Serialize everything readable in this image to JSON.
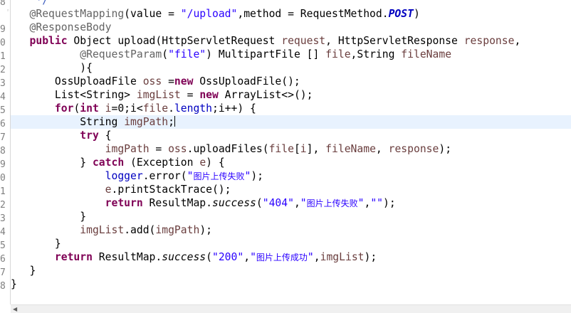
{
  "gutter": {
    "line_numbers": [
      "8",
      "9",
      "0",
      "1",
      "2",
      "3",
      "4",
      "5",
      "6",
      "7",
      "8",
      "9",
      "0",
      "1",
      "2",
      "3",
      "4",
      "5",
      "6",
      "7",
      "8"
    ]
  },
  "code": {
    "comment_tail": "*/",
    "annotation_mapping": "@RequestMapping",
    "mapping_args_a": "(value = ",
    "mapping_url": "\"/upload\"",
    "mapping_args_b": ",method = RequestMethod.",
    "mapping_post": "POST",
    "mapping_close": ")",
    "annotation_body": "@ResponseBody",
    "kw_public": "public",
    "sig_a": " Object upload(HttpServletRequest ",
    "param_request": "request",
    "sig_b": ", HttpServletResponse ",
    "param_response": "response",
    "sig_c": ",",
    "annotation_param": "@RequestParam",
    "param_ann_open": "(",
    "param_ann_value": "\"file\"",
    "param_ann_close": ")",
    "sig_d": " MultipartFile [] ",
    "param_file": "file",
    "sig_e": ",String ",
    "param_filename": "fileName",
    "sig_close": "){",
    "l4_a": "OssUploadFile ",
    "l4_var": "oss",
    "l4_b": " =",
    "kw_new": "new",
    "l4_c": " OssUploadFile();",
    "l5_a": "List<String> ",
    "l5_var": "imgList",
    "l5_b": " = ",
    "l5_c": " ArrayList<>();",
    "kw_for": "for",
    "l6_a": "(",
    "kw_int": "int",
    "l6_var_i": " i",
    "l6_b": "=0;i<",
    "l6_file": "file",
    "l6_c": ".",
    "l6_length": "length",
    "l6_d": ";i++) {",
    "l7_a": "String ",
    "l7_var": "imgPath",
    "l7_b": ";",
    "kw_try": "try",
    "l8_b": " {",
    "l9_var": "imgPath",
    "l9_a": " = ",
    "l9_oss": "oss",
    "l9_b": ".uploadFiles(",
    "l9_file": "file",
    "l9_c": "[",
    "l9_i": "i",
    "l9_d": "], ",
    "l9_filename": "fileName",
    "l9_e": ", ",
    "l9_response": "response",
    "l9_f": ");",
    "l10_a": "} ",
    "kw_catch": "catch",
    "l10_b": " (Exception ",
    "l10_e": "e",
    "l10_c": ") {",
    "l11_logger": "logger",
    "l11_a": ".error(",
    "l11_q1": "\"",
    "l11_msg": "图片上传失败",
    "l11_q2": "\"",
    "l11_b": ");",
    "l12_e": "e",
    "l12_a": ".printStackTrace();",
    "kw_return": "return",
    "l13_a": " ResultMap.",
    "l13_success": "success",
    "l13_b": "(",
    "l13_code": "\"404\"",
    "l13_c": ",",
    "l13_q1": "\"",
    "l13_msg": "图片上传失败",
    "l13_q2": "\"",
    "l13_d": ",",
    "l13_empty": "\"\"",
    "l13_e": ");",
    "brace_close": "}",
    "l15_var": "imgList",
    "l15_a": ".add(",
    "l15_arg": "imgPath",
    "l15_b": ");",
    "l17_a": " ResultMap.",
    "l17_success": "success",
    "l17_b": "(",
    "l17_code": "\"200\"",
    "l17_c": ",",
    "l17_q1": "\"",
    "l17_msg": "图片上传成功",
    "l17_q2": "\"",
    "l17_d": ",",
    "l17_var": "imgList",
    "l17_e": ");"
  },
  "colors": {
    "keyword": "#7f0055",
    "string": "#2a00ff",
    "field": "#0000c0",
    "annotation": "#646464",
    "parameter": "#6a3e3e",
    "comment": "#3f5fbf",
    "current_line": "#e8f2fe"
  },
  "icons": {
    "fold_marker": "fold-collapse-icon",
    "scroll_left": "scroll-left-arrow-icon"
  }
}
